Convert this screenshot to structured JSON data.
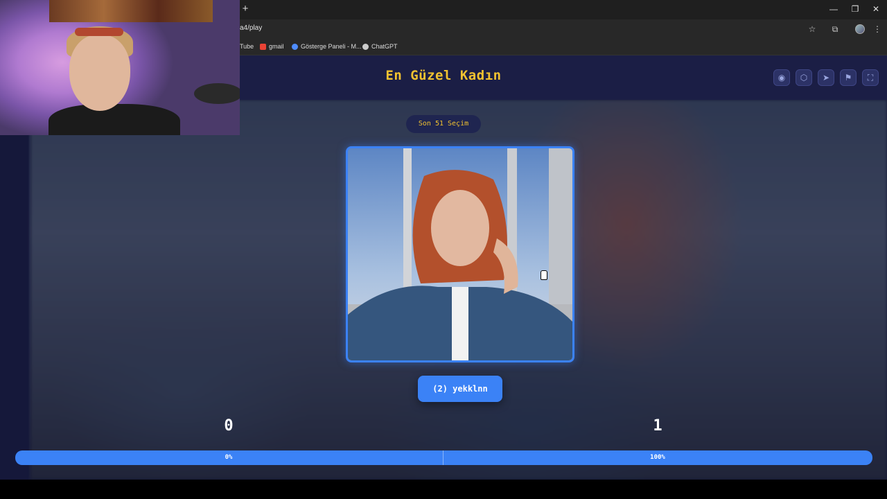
{
  "browser": {
    "new_tab_glyph": "+",
    "url": "a4/play",
    "window_controls": {
      "minimize": "—",
      "restore": "❐",
      "close": "✕"
    },
    "toolbar_icons": [
      "star-icon",
      "extensions-icon",
      "menu-icon"
    ],
    "bookmarks": [
      {
        "label": "Tube",
        "icon": "youtube-icon",
        "color": "#ff0000"
      },
      {
        "label": "gmail",
        "icon": "gmail-icon",
        "color": "#ea4335"
      },
      {
        "label": "Gösterge Paneli - M...",
        "icon": "dashboard-icon",
        "color": "#4e8cff"
      },
      {
        "label": "ChatGPT",
        "icon": "chatgpt-icon",
        "color": "#cccccc"
      }
    ]
  },
  "header": {
    "title": "En Güzel Kadın",
    "buttons": [
      {
        "name": "eye-icon",
        "glyph": "◉"
      },
      {
        "name": "share-icon",
        "glyph": "⬡"
      },
      {
        "name": "send-icon",
        "glyph": "➤"
      },
      {
        "name": "flag-icon",
        "glyph": "⚑"
      },
      {
        "name": "fullscreen-icon",
        "glyph": "⛶"
      }
    ]
  },
  "game": {
    "round_label": "Son 51 Seçim",
    "choose_label": "(2) yekklnn",
    "left_score": "0",
    "right_score": "1",
    "left_percent": "0%",
    "right_percent": "100%",
    "progress_left_fraction": 0.0,
    "progress_right_fraction": 1.0
  },
  "colors": {
    "accent": "#3b82f6",
    "title": "#f2c230",
    "background": "#15183a"
  }
}
